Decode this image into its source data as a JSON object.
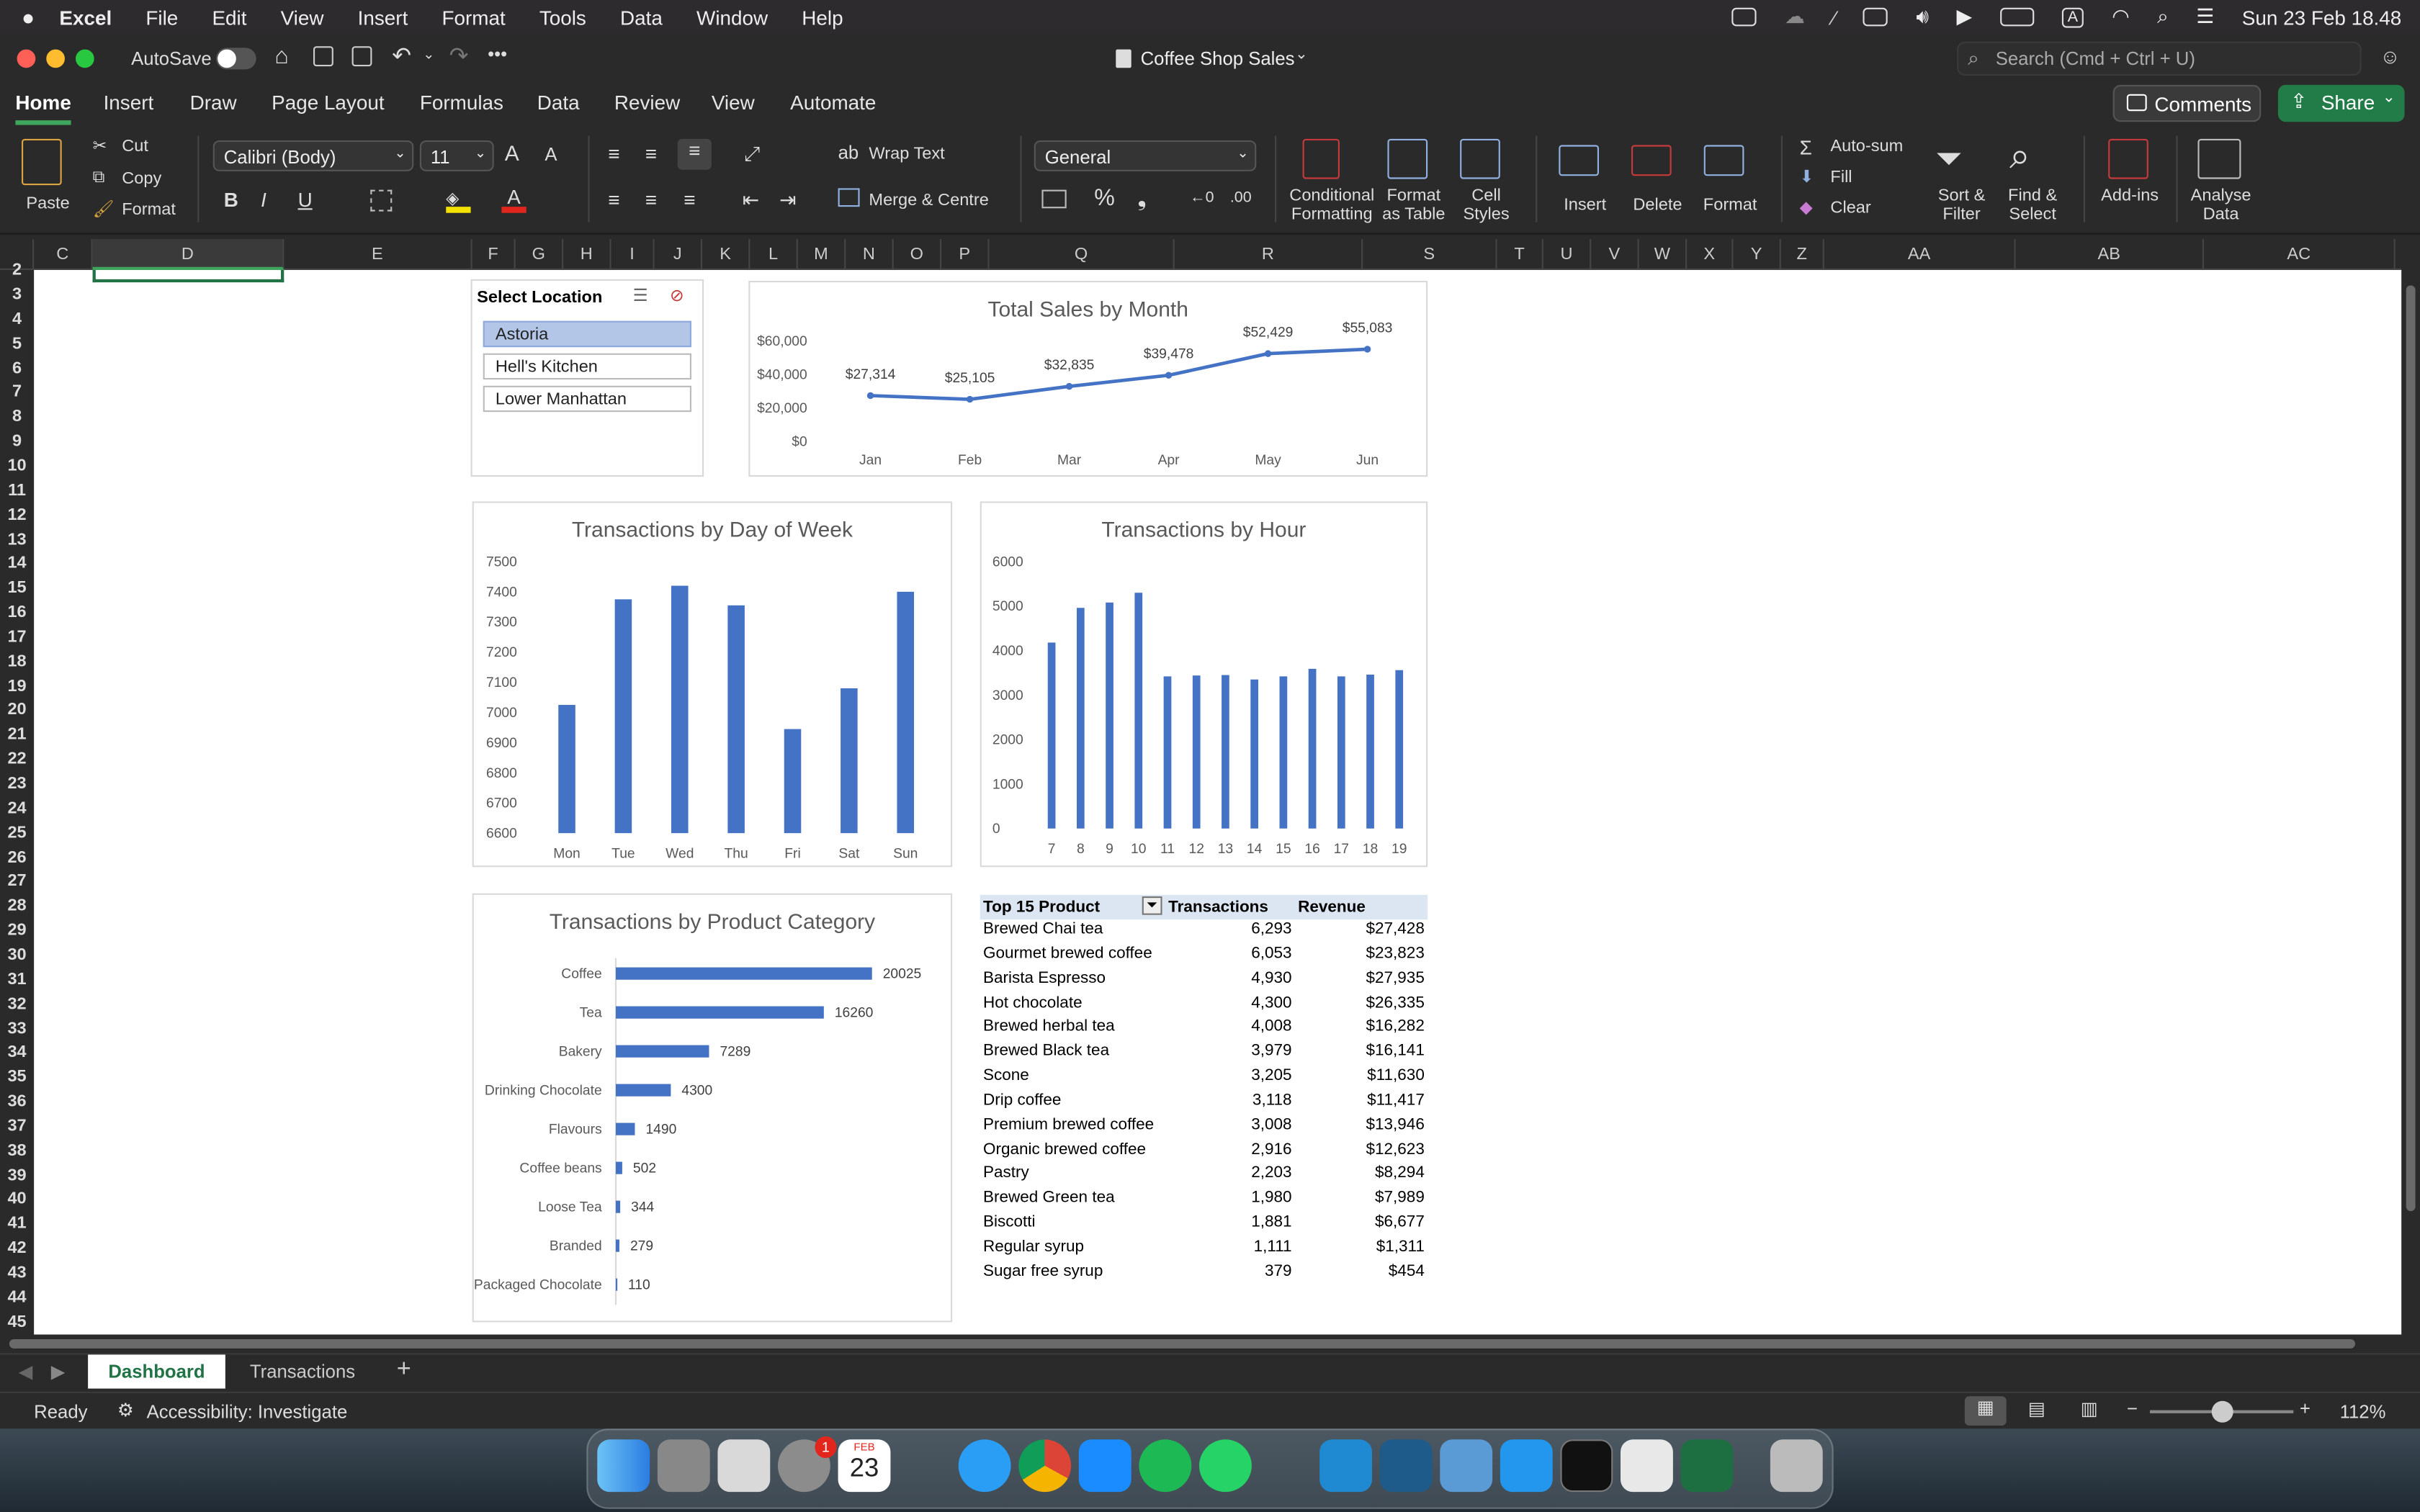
{
  "menubar": {
    "app": "Excel",
    "items": [
      "File",
      "Edit",
      "View",
      "Insert",
      "Format",
      "Tools",
      "Data",
      "Window",
      "Help"
    ],
    "clock": "Sun 23 Feb  18.48"
  },
  "titlebar": {
    "autosave": "AutoSave",
    "doc_title": "Coffee Shop Sales",
    "search_placeholder": "Search (Cmd + Ctrl + U)"
  },
  "ribbon_tabs": [
    "Home",
    "Insert",
    "Draw",
    "Page Layout",
    "Formulas",
    "Data",
    "Review",
    "View",
    "Automate"
  ],
  "buttons": {
    "comments": "Comments",
    "share": "Share"
  },
  "ribbon": {
    "paste": "Paste",
    "cut": "Cut",
    "copy": "Copy",
    "format": "Format",
    "font_name": "Calibri (Body)",
    "font_size": "11",
    "bold": "B",
    "italic": "I",
    "underline": "U",
    "wrap_text": "Wrap Text",
    "merge_centre": "Merge & Centre",
    "number_format": "General",
    "conditional_formatting": [
      "Conditional",
      "Formatting"
    ],
    "format_as_table": [
      "Format",
      "as Table"
    ],
    "cell_styles": [
      "Cell",
      "Styles"
    ],
    "insert": "Insert",
    "delete": "Delete",
    "format_cells": "Format",
    "auto_sum": "Auto-sum",
    "fill": "Fill",
    "clear": "Clear",
    "sort_filter": [
      "Sort &",
      "Filter"
    ],
    "find_select": [
      "Find &",
      "Select"
    ],
    "add_ins": "Add-ins",
    "analyse_data": [
      "Analyse",
      "Data"
    ]
  },
  "columns": [
    "C",
    "D",
    "E",
    "F",
    "G",
    "H",
    "I",
    "J",
    "K",
    "L",
    "M",
    "N",
    "O",
    "P",
    "Q",
    "R",
    "S",
    "T",
    "U",
    "V",
    "W",
    "X",
    "Y",
    "Z",
    "AA",
    "AB",
    "AC"
  ],
  "rows": [
    "2",
    "3",
    "4",
    "5",
    "6",
    "7",
    "8",
    "9",
    "10",
    "11",
    "12",
    "13",
    "14",
    "15",
    "16",
    "17",
    "18",
    "19",
    "20",
    "21",
    "22",
    "23",
    "24",
    "25",
    "26",
    "27",
    "28",
    "29",
    "30",
    "31",
    "32",
    "33",
    "34",
    "35",
    "36",
    "37",
    "38",
    "39",
    "40",
    "41",
    "42",
    "43",
    "44",
    "45"
  ],
  "slicer": {
    "title": "Select Location",
    "items": [
      "Astoria",
      "Hell's Kitchen",
      "Lower Manhattan"
    ],
    "selected": "Astoria"
  },
  "chart_data": [
    {
      "id": "monthly",
      "type": "line",
      "title": "Total Sales by Month",
      "categories": [
        "Jan",
        "Feb",
        "Mar",
        "Apr",
        "May",
        "Jun"
      ],
      "values": [
        27314,
        25105,
        32835,
        39478,
        52429,
        55083
      ],
      "data_labels": [
        "$27,314",
        "$25,105",
        "$32,835",
        "$39,478",
        "$52,429",
        "$55,083"
      ],
      "yticks": [
        "$0",
        "$20,000",
        "$40,000",
        "$60,000"
      ],
      "ylim": [
        0,
        60000
      ],
      "color": "#4472c4"
    },
    {
      "id": "dow",
      "type": "bar",
      "title": "Transactions by Day of Week",
      "categories": [
        "Mon",
        "Tue",
        "Wed",
        "Thu",
        "Fri",
        "Sat",
        "Sun"
      ],
      "values": [
        7025,
        7375,
        7420,
        7355,
        6945,
        7080,
        7400
      ],
      "yticks": [
        "6600",
        "6700",
        "6800",
        "6900",
        "7000",
        "7100",
        "7200",
        "7300",
        "7400",
        "7500"
      ],
      "ylim": [
        6600,
        7500
      ],
      "color": "#4472c4"
    },
    {
      "id": "hour",
      "type": "bar",
      "title": "Transactions by Hour",
      "categories": [
        "7",
        "8",
        "9",
        "10",
        "11",
        "12",
        "13",
        "14",
        "15",
        "16",
        "17",
        "18",
        "19"
      ],
      "values": [
        4180,
        4960,
        5080,
        5300,
        3420,
        3440,
        3450,
        3350,
        3420,
        3590,
        3420,
        3460,
        3560
      ],
      "yticks": [
        "0",
        "1000",
        "2000",
        "3000",
        "4000",
        "5000",
        "6000"
      ],
      "ylim": [
        0,
        6000
      ],
      "color": "#4472c4"
    },
    {
      "id": "category",
      "type": "bar",
      "orientation": "horizontal",
      "title": "Transactions by Product Category",
      "categories": [
        "Coffee",
        "Tea",
        "Bakery",
        "Drinking Chocolate",
        "Flavours",
        "Coffee beans",
        "Loose Tea",
        "Branded",
        "Packaged Chocolate"
      ],
      "values": [
        20025,
        16260,
        7289,
        4300,
        1490,
        502,
        344,
        279,
        110
      ],
      "data_labels": [
        "20025",
        "16260",
        "7289",
        "4300",
        "1490",
        "502",
        "344",
        "279",
        "110"
      ],
      "xlim": [
        0,
        20025
      ],
      "color": "#4472c4"
    }
  ],
  "table": {
    "headers": [
      "Top 15 Product",
      "Transactions",
      "Revenue"
    ],
    "rows": [
      [
        "Brewed Chai tea",
        "6,293",
        "$27,428"
      ],
      [
        "Gourmet brewed coffee",
        "6,053",
        "$23,823"
      ],
      [
        "Barista Espresso",
        "4,930",
        "$27,935"
      ],
      [
        "Hot chocolate",
        "4,300",
        "$26,335"
      ],
      [
        "Brewed herbal tea",
        "4,008",
        "$16,282"
      ],
      [
        "Brewed Black tea",
        "3,979",
        "$16,141"
      ],
      [
        "Scone",
        "3,205",
        "$11,630"
      ],
      [
        "Drip coffee",
        "3,118",
        "$11,417"
      ],
      [
        "Premium brewed coffee",
        "3,008",
        "$13,946"
      ],
      [
        "Organic brewed coffee",
        "2,916",
        "$12,623"
      ],
      [
        "Pastry",
        "2,203",
        "$8,294"
      ],
      [
        "Brewed Green tea",
        "1,980",
        "$7,989"
      ],
      [
        "Biscotti",
        "1,881",
        "$6,677"
      ],
      [
        "Regular syrup",
        "1,111",
        "$1,311"
      ],
      [
        "Sugar free syrup",
        "379",
        "$454"
      ]
    ]
  },
  "sheet_tabs": [
    "Dashboard",
    "Transactions"
  ],
  "status": {
    "ready": "Ready",
    "accessibility": "Accessibility: Investigate",
    "zoom": "112%"
  },
  "dock": {
    "badge": "1",
    "calendar_month": "FEB",
    "calendar_day": "23"
  },
  "colors": {
    "accent_green": "#3ea55d",
    "share_green": "#227c48",
    "chart_blue": "#4472c4",
    "table_header": "#dce6f2"
  }
}
